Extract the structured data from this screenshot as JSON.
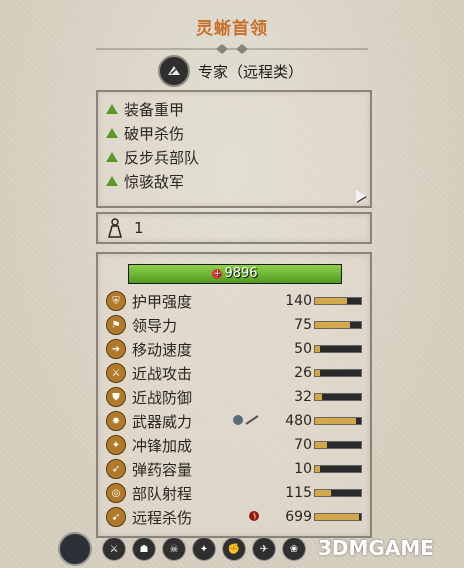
{
  "header": {
    "title": "灵蜥首领"
  },
  "unit_type": {
    "icon": "ranged-specialist-icon",
    "label": "专家（远程类）"
  },
  "abilities": [
    {
      "label": "装备重甲"
    },
    {
      "label": "破甲杀伤"
    },
    {
      "label": "反步兵部队"
    },
    {
      "label": "惊骇敌军"
    }
  ],
  "rank": {
    "icon": "rank-icon",
    "value": "1"
  },
  "health": {
    "value": "9896",
    "fill": 1.0
  },
  "stats": [
    {
      "icon": "armor-icon",
      "label": "护甲强度",
      "value": "140",
      "extra": "",
      "fill": 0.7
    },
    {
      "icon": "leadership-icon",
      "label": "领导力",
      "value": "75",
      "extra": "",
      "fill": 0.75
    },
    {
      "icon": "speed-icon",
      "label": "移动速度",
      "value": "50",
      "extra": "",
      "fill": 0.1
    },
    {
      "icon": "melee-attack-icon",
      "label": "近战攻击",
      "value": "26",
      "extra": "",
      "fill": 0.1
    },
    {
      "icon": "melee-defense-icon",
      "label": "近战防御",
      "value": "32",
      "extra": "",
      "fill": 0.15
    },
    {
      "icon": "weapon-strength-icon",
      "label": "武器威力",
      "value": "480",
      "extra": "armor-pierce + anti-large",
      "fill": 0.9
    },
    {
      "icon": "charge-bonus-icon",
      "label": "冲锋加成",
      "value": "70",
      "extra": "",
      "fill": 0.25
    },
    {
      "icon": "ammo-icon",
      "label": "弹药容量",
      "value": "10",
      "extra": "",
      "fill": 0.1
    },
    {
      "icon": "range-icon",
      "label": "部队射程",
      "value": "115",
      "extra": "",
      "fill": 0.35
    },
    {
      "icon": "missile-damage-icon",
      "label": "远程杀伤",
      "value": "699",
      "extra": "fire-damage",
      "fill": 0.95
    }
  ],
  "bottom_bar": {
    "main_icon": "faction-emblem-icon",
    "icons": [
      "attribute-icon-1",
      "attribute-icon-2",
      "attribute-icon-3",
      "attribute-icon-4",
      "attribute-icon-5",
      "attribute-icon-6",
      "attribute-icon-7",
      "attribute-icon-8",
      "attribute-icon-9"
    ]
  },
  "watermark": "3DMGAME",
  "colors": {
    "title": "#c9702a",
    "ability_marker": "#5c9a2a",
    "hp_fill": "#6fbe33",
    "stat_fill": "#d4a84a"
  }
}
